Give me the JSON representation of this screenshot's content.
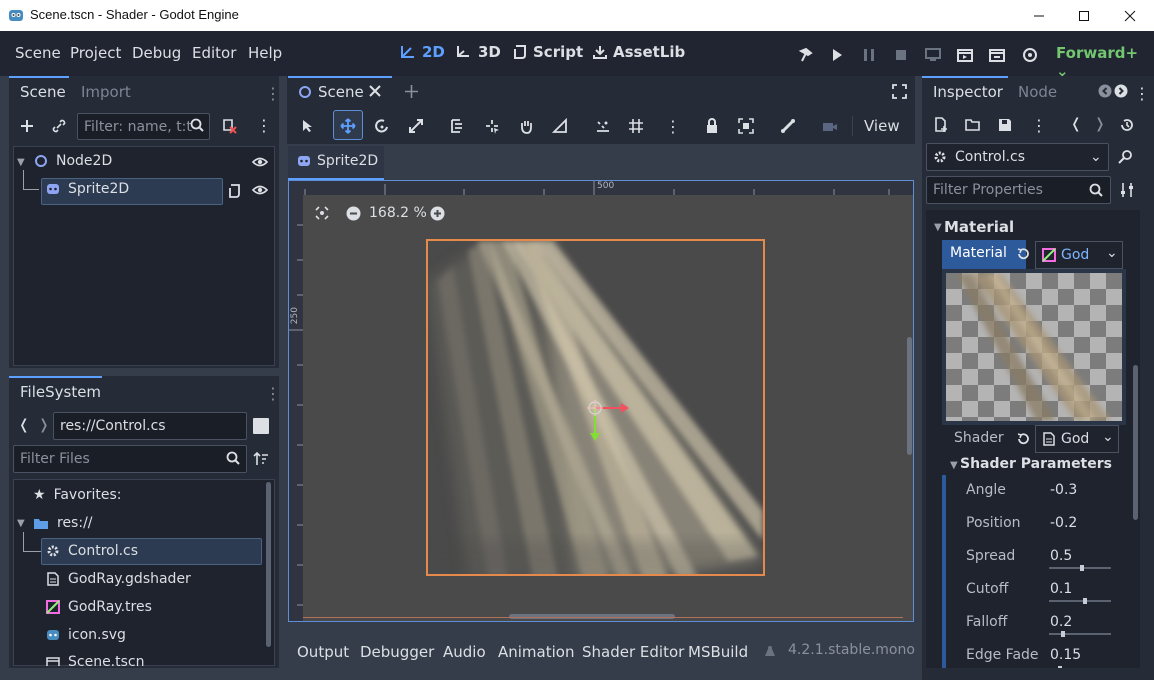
{
  "window": {
    "title": "Scene.tscn - Shader - Godot Engine"
  },
  "menu": {
    "items": [
      "Scene",
      "Project",
      "Debug",
      "Editor",
      "Help"
    ]
  },
  "modes": {
    "two_d": "2D",
    "three_d": "3D",
    "script": "Script",
    "assetlib": "AssetLib"
  },
  "renderer": "Forward+",
  "scene_dock": {
    "tab_scene": "Scene",
    "tab_import": "Import",
    "filter_placeholder": "Filter: name, t:t",
    "tree": [
      {
        "label": "Node2D",
        "icon": "node2d-icon"
      },
      {
        "label": "Sprite2D",
        "icon": "sprite2d-icon"
      }
    ]
  },
  "filesystem": {
    "title": "FileSystem",
    "path": "res://Control.cs",
    "filter_placeholder": "Filter Files",
    "favorites": "Favorites:",
    "root": "res://",
    "files": [
      "Control.cs",
      "GodRay.gdshader",
      "GodRay.tres",
      "icon.svg",
      "Scene.tscn"
    ]
  },
  "editor": {
    "tab_label": "Scene",
    "view_label": "View",
    "node_tab": "Sprite2D",
    "zoom": "168.2 %",
    "ruler_top": "500",
    "ruler_left": "250"
  },
  "inspector": {
    "tab_inspector": "Inspector",
    "tab_node": "Node",
    "object": "Control.cs",
    "filter_placeholder": "Filter Properties",
    "section_material": "Material",
    "material_label": "Material",
    "material_value": "God",
    "shader_label": "Shader",
    "shader_value": "God",
    "shader_params_title": "Shader Parameters",
    "params": [
      {
        "label": "Angle",
        "value": "-0.3"
      },
      {
        "label": "Position",
        "value": "-0.2"
      },
      {
        "label": "Spread",
        "value": "0.5",
        "slider": 0.5
      },
      {
        "label": "Cutoff",
        "value": "0.1",
        "slider": 0.55
      },
      {
        "label": "Falloff",
        "value": "0.2",
        "slider": 0.2
      },
      {
        "label": "Edge Fade",
        "value": "0.15",
        "slider": 0.15
      }
    ]
  },
  "bottom": {
    "tabs": [
      "Output",
      "Debugger",
      "Audio",
      "Animation",
      "Shader Editor",
      "MSBuild"
    ],
    "version": "4.2.1.stable.mono"
  },
  "colors": {
    "accent": "#5ea0ff",
    "panel": "#252b37",
    "renderer": "#73c76f",
    "selection": "#e58a4c"
  }
}
